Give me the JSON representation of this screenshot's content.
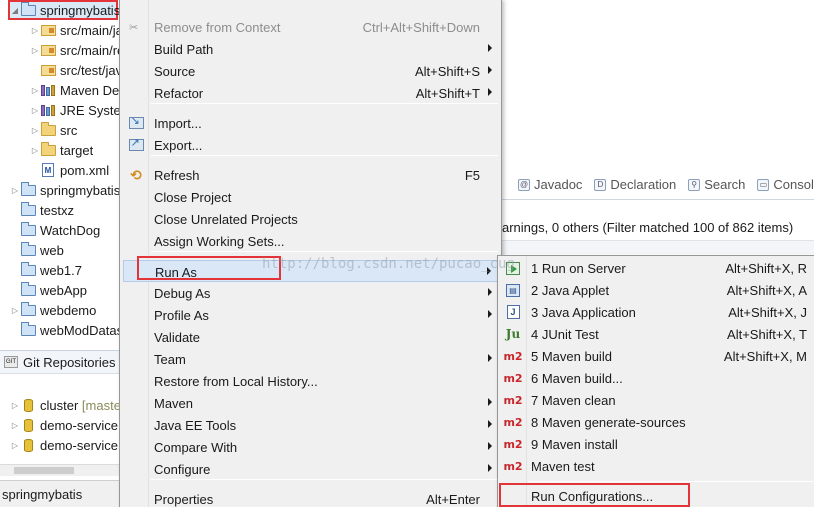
{
  "explorer": {
    "items": [
      {
        "label": "springmybatis",
        "icon": "maven-project-icon",
        "expanded": true,
        "indent": 0
      },
      {
        "label": "src/main/java",
        "icon": "package-folder-icon",
        "expanded": false,
        "indent": 1
      },
      {
        "label": "src/main/resources",
        "icon": "package-folder-icon",
        "expanded": false,
        "indent": 1
      },
      {
        "label": "src/test/java",
        "icon": "package-folder-icon",
        "expanded": null,
        "indent": 1
      },
      {
        "label": "Maven Dependencies",
        "icon": "library-icon",
        "expanded": false,
        "indent": 1
      },
      {
        "label": "JRE System Library",
        "icon": "library-icon",
        "expanded": false,
        "indent": 1
      },
      {
        "label": "src",
        "icon": "folder-icon",
        "expanded": false,
        "indent": 1
      },
      {
        "label": "target",
        "icon": "folder-icon",
        "expanded": false,
        "indent": 1
      },
      {
        "label": "pom.xml",
        "icon": "xml-file-icon",
        "expanded": null,
        "indent": 1
      },
      {
        "label": "springmybatis",
        "icon": "maven-project-icon",
        "expanded": false,
        "indent": 0
      },
      {
        "label": "testxz",
        "icon": "project-icon",
        "expanded": null,
        "indent": 0
      },
      {
        "label": "WatchDog",
        "icon": "project-icon",
        "expanded": null,
        "indent": 0
      },
      {
        "label": "web",
        "icon": "project-icon",
        "expanded": null,
        "indent": 0
      },
      {
        "label": "web1.7",
        "icon": "project-icon",
        "expanded": null,
        "indent": 0
      },
      {
        "label": "webApp",
        "icon": "project-icon",
        "expanded": null,
        "indent": 0
      },
      {
        "label": "webdemo",
        "icon": "maven-project-icon",
        "expanded": false,
        "indent": 0
      },
      {
        "label": "webModDatas",
        "icon": "project-icon",
        "expanded": null,
        "indent": 0
      }
    ]
  },
  "git": {
    "title": "Git Repositories",
    "repos": [
      {
        "name": "cluster",
        "branch": "[master]"
      },
      {
        "name": "demo-service",
        "branch": ""
      },
      {
        "name": "demo-service",
        "branch": ""
      }
    ]
  },
  "status_bar": {
    "selection": "springmybatis"
  },
  "background": {
    "tabs": [
      {
        "label": "Javadoc",
        "icon": "javadoc-icon"
      },
      {
        "label": "Declaration",
        "icon": "declaration-icon"
      },
      {
        "label": "Search",
        "icon": "search-icon"
      },
      {
        "label": "Console",
        "icon": "console-icon"
      }
    ],
    "problems_status": "arnings, 0 others (Filter matched 100 of 862 items)"
  },
  "context_menu": {
    "items": [
      {
        "label": "Remove from Context",
        "shortcut": "Ctrl+Alt+Shift+Down",
        "disabled": true,
        "icon": "remove-context-icon"
      },
      {
        "label": "Build Path",
        "submenu": true
      },
      {
        "label": "Source",
        "shortcut": "Alt+Shift+S",
        "submenu": true
      },
      {
        "label": "Refactor",
        "shortcut": "Alt+Shift+T",
        "submenu": true
      },
      {
        "sep": true
      },
      {
        "label": "Import...",
        "icon": "import-icon"
      },
      {
        "label": "Export...",
        "icon": "export-icon"
      },
      {
        "sep": true
      },
      {
        "label": "Refresh",
        "shortcut": "F5",
        "icon": "refresh-icon"
      },
      {
        "label": "Close Project"
      },
      {
        "label": "Close Unrelated Projects"
      },
      {
        "label": "Assign Working Sets..."
      },
      {
        "sep": true
      },
      {
        "label": "Run As",
        "submenu": true,
        "active": true
      },
      {
        "label": "Debug As",
        "submenu": true
      },
      {
        "label": "Profile As",
        "submenu": true
      },
      {
        "label": "Validate"
      },
      {
        "label": "Team",
        "submenu": true
      },
      {
        "label": "Restore from Local History..."
      },
      {
        "label": "Maven",
        "submenu": true
      },
      {
        "label": "Java EE Tools",
        "submenu": true
      },
      {
        "label": "Compare With",
        "submenu": true
      },
      {
        "label": "Configure",
        "submenu": true
      },
      {
        "sep": true
      },
      {
        "label": "Properties",
        "shortcut": "Alt+Enter"
      }
    ]
  },
  "run_as_submenu": {
    "items": [
      {
        "label": "1 Run on Server",
        "shortcut": "Alt+Shift+X, R",
        "icon": "run-on-server-icon"
      },
      {
        "label": "2 Java Applet",
        "shortcut": "Alt+Shift+X, A",
        "icon": "java-applet-icon"
      },
      {
        "label": "3 Java Application",
        "shortcut": "Alt+Shift+X, J",
        "icon": "java-application-icon"
      },
      {
        "label": "4 JUnit Test",
        "shortcut": "Alt+Shift+X, T",
        "icon": "junit-icon"
      },
      {
        "label": "5 Maven build",
        "shortcut": "Alt+Shift+X, M",
        "icon": "maven-m2-icon"
      },
      {
        "label": "6 Maven build...",
        "shortcut": "",
        "icon": "maven-m2-icon"
      },
      {
        "label": "7 Maven clean",
        "shortcut": "",
        "icon": "maven-m2-icon"
      },
      {
        "label": "8 Maven generate-sources",
        "shortcut": "",
        "icon": "maven-m2-icon"
      },
      {
        "label": "9 Maven install",
        "shortcut": "",
        "icon": "maven-m2-icon"
      },
      {
        "label": "Maven test",
        "shortcut": "",
        "icon": "maven-m2-icon"
      },
      {
        "sep": true
      },
      {
        "label": "Run Configurations...",
        "shortcut": ""
      }
    ]
  },
  "icon_text": {
    "junit": "Ju",
    "m2": "m2",
    "applet": "▤",
    "japp": "J",
    "git": "GIT",
    "xml": "M"
  },
  "watermark": "http://blog.csdn.net/pucao_cug",
  "colors": {
    "highlight_red": "#e3343a",
    "menu_bg": "#f0f0f0",
    "selection_bg": "#dbe8f6"
  }
}
